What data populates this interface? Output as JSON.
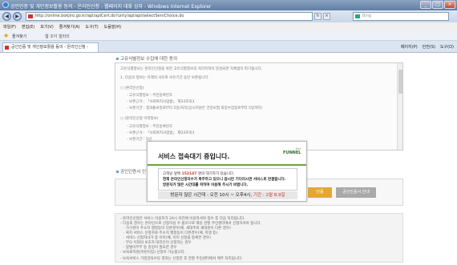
{
  "window": {
    "title": "공인인증 및 개인정보활용 동의 - 온라인신청 - 웹페이지 대화 상자 - Windows Internet Explorer",
    "buttons": [
      "_",
      "□",
      "×"
    ]
  },
  "address": {
    "url": "http://online.bokjiro.go.kr/apl/aplCert.do?unty/apl/apl/selectServChoice.do",
    "search_placeholder": "Bing"
  },
  "menu": [
    "파일(F)",
    "편집(E)",
    "보기(V)",
    "즐겨찾기(A)",
    "도구(T)",
    "도움말(H)"
  ],
  "favorites": {
    "label": "즐겨찾기",
    "extra": "웹 조각 갤러리"
  },
  "tab": {
    "label": "공인인증 및 개인정보활용 동의 - 온라인신청 -",
    "commands": [
      "페이지(P)",
      "안전(S)",
      "도구(O)"
    ]
  },
  "content": {
    "section_title": "고유식별정보 수집에 대한 동의",
    "scroll_lines": [
      "고유식별정보는 온라인신청을 위한 고유식별정보의 처리목적이 달성되면 지체없이 파기됩니다.",
      "1. 다음의 정보는 이래의 사유로 보유기간 동안 보존됩니다.",
      "○ (온라인신청)",
      "- 고유식별정보 : 주민등록번호",
      "- 보존근거 : 「사회복지사업법」 제33조의3",
      "- 보존기간 : 결과통보일로부터 5일(처리(상시지원은 건강보험 최종수집일로부터 5일까지)",
      "○ (온라인신청 이력정보)",
      "- 고유식별정보 : 주민등록번호",
      "- 보존근거 : 「사회복지사업법」 제33조의3",
      "- 보존기간 : 5년"
    ],
    "cert_section_title": "공인인증서 인",
    "cert_buttons": [
      "인증",
      "공인인증서 안내"
    ],
    "notice_lines": [
      "- 온라인신청은 서비스 이용자가 24시 이전에 이용하셔야 접수 후 다음 처리됩니다.",
      "- 다음의 경우는 온라인으로 신청하실 수 없으므로 해당 관할 주민센터에서 신청하셔야 합니다.",
      "· 가구원이 주소지 행정동이 다른경우(예, 세대주와 세대원이 다른 경우)",
      "· 복지 서비스 신청자와 주소지 행정동이 다른경우(예, 학생 등)",
      "· 서비스 신청자녀가 중 이미(예, 이미 신청을 등록한 경우)",
      "· 부모 이외의 보호자 대리인이 신청하는 경우",
      "· 맞벌이부부 등 증빙이 필요한 경우",
      "- 보육료지원(어린이집) 신청이 가능합니다.",
      "- 보육서비스 가정양육수당 결과는 신청한 후 관할 주민센터에서 매주 처리됩니다."
    ]
  },
  "overlay": {
    "title": "서비스 접속대기 중입니다.",
    "logo_small": "Net",
    "logo_big": "FUNNEL",
    "line1_pre": "고객님 앞에",
    "line1_num": "152147",
    "line1_post": "명의 대기자가 있습니다.",
    "line2": "현재 온라인신청자수가 폭주하고 있으니 잠시만 기다리시면 서비스로 연결됩니다.",
    "line3": "방문자가 많은 시간대를 피하여 이용해 주시기 바랍니다.",
    "footer_pre": "방문자 많은 시간대 : 오전 10시 ~ 오후4시,",
    "footer_post": "기간 : 2월 8,9일"
  }
}
